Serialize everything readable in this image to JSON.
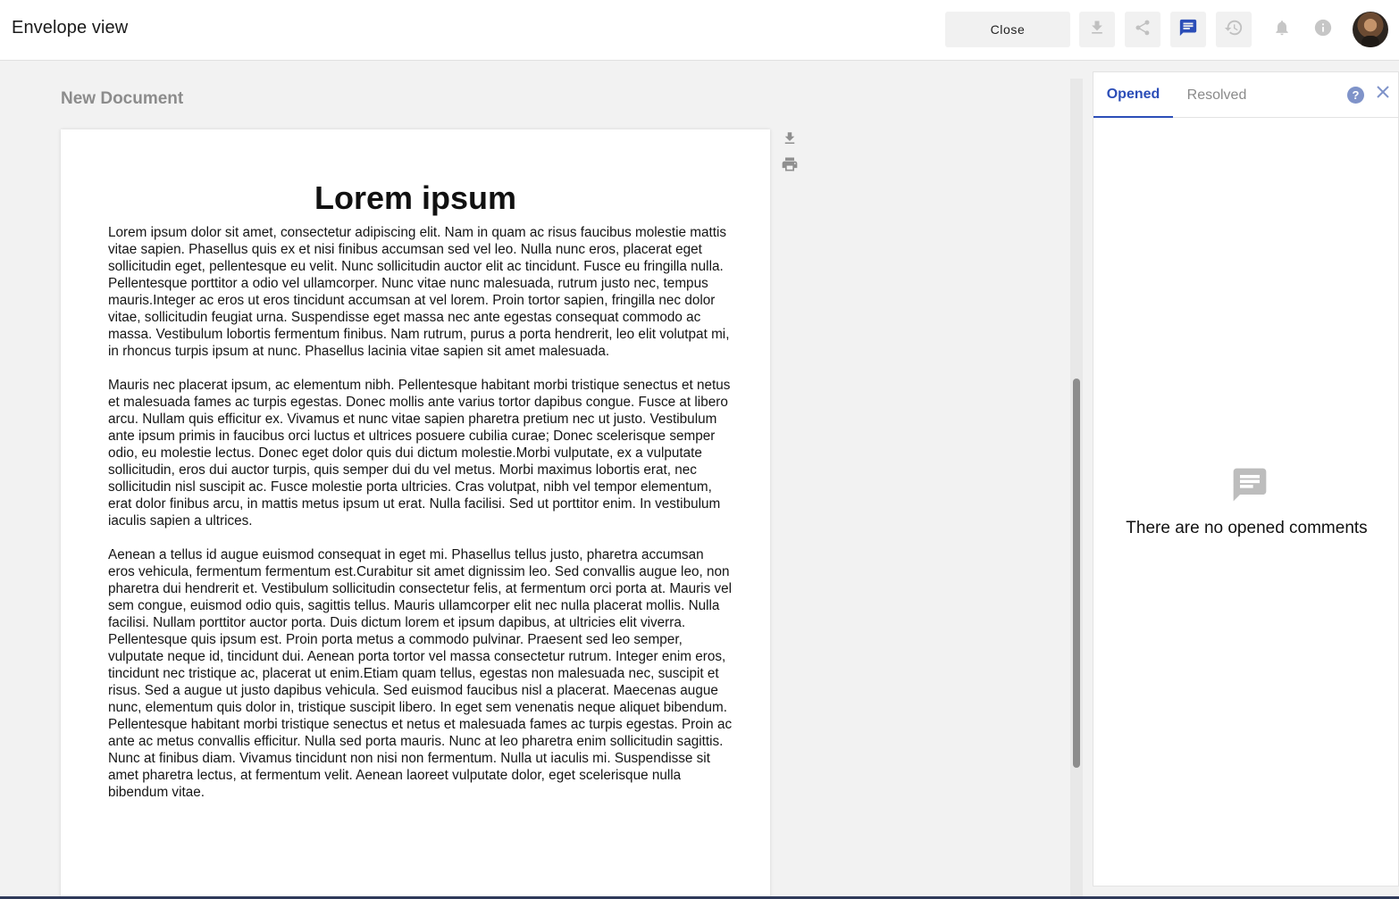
{
  "header": {
    "title": "Envelope view",
    "close_label": "Close"
  },
  "document": {
    "name": "New Document",
    "heading": "Lorem ipsum",
    "paragraphs": [
      "Lorem ipsum dolor sit amet, consectetur adipiscing elit. Nam in quam ac risus faucibus molestie mattis vitae sapien. Phasellus quis ex et nisi finibus accumsan sed vel leo. Nulla nunc eros, placerat eget sollicitudin eget, pellentesque eu velit. Nunc sollicitudin auctor elit ac tincidunt. Fusce eu fringilla nulla. Pellentesque porttitor a odio vel ullamcorper. Nunc vitae nunc malesuada, rutrum justo nec, tempus mauris.Integer ac eros ut eros tincidunt accumsan at vel lorem. Proin tortor sapien, fringilla nec dolor vitae, sollicitudin feugiat urna. Suspendisse eget massa nec ante egestas consequat commodo ac massa. Vestibulum lobortis fermentum finibus. Nam rutrum, purus a porta hendrerit, leo elit volutpat mi, in rhoncus turpis ipsum at nunc. Phasellus lacinia vitae sapien sit amet malesuada.",
      "Mauris nec placerat ipsum, ac elementum nibh. Pellentesque habitant morbi tristique senectus et netus et malesuada fames ac turpis egestas. Donec mollis ante varius tortor dapibus congue. Fusce at libero arcu. Nullam quis efficitur ex. Vivamus et nunc vitae sapien pharetra pretium nec ut justo. Vestibulum ante ipsum primis in faucibus orci luctus et ultrices posuere cubilia curae; Donec scelerisque semper odio, eu molestie lectus. Donec eget dolor quis dui dictum molestie.Morbi vulputate, ex a vulputate sollicitudin, eros dui auctor turpis, quis semper dui du vel metus. Morbi maximus lobortis erat, nec sollicitudin nisl suscipit ac. Fusce molestie porta ultricies. Cras volutpat, nibh vel tempor elementum, erat dolor finibus arcu, in mattis metus ipsum ut erat. Nulla facilisi. Sed ut porttitor enim. In vestibulum iaculis sapien a ultrices.",
      "Aenean a tellus id augue euismod consequat in eget mi. Phasellus tellus justo, pharetra accumsan eros vehicula, fermentum fermentum est.Curabitur sit amet dignissim leo. Sed convallis augue leo, non pharetra dui hendrerit et. Vestibulum sollicitudin consectetur felis, at fermentum orci porta at. Mauris vel sem congue, euismod odio quis, sagittis tellus. Mauris ullamcorper elit nec nulla placerat mollis. Nulla facilisi. Nullam porttitor auctor porta. Duis dictum lorem et ipsum dapibus, at ultricies elit viverra. Pellentesque quis ipsum est. Proin porta metus a commodo pulvinar. Praesent sed leo semper, vulputate neque id, tincidunt dui. Aenean porta tortor vel massa consectetur rutrum. Integer enim eros, tincidunt nec tristique ac, placerat ut enim.Etiam quam tellus, egestas non malesuada nec, suscipit et risus. Sed a augue ut justo dapibus vehicula. Sed euismod faucibus nisl a placerat. Maecenas augue nunc, elementum quis dolor in, tristique suscipit libero. In eget sem venenatis neque aliquet bibendum. Pellentesque habitant morbi tristique senectus et netus et malesuada fames ac turpis egestas. Proin ac ante ac metus convallis efficitur. Nulla sed porta mauris. Nunc at leo pharetra enim sollicitudin sagittis. Nunc at finibus diam. Vivamus tincidunt non nisi non fermentum. Nulla ut iaculis mi. Suspendisse sit amet pharetra lectus, at fermentum velit. Aenean laoreet vulputate dolor, eget scelerisque nulla bibendum vitae."
    ]
  },
  "comments_panel": {
    "tabs": [
      "Opened",
      "Resolved"
    ],
    "active_tab": "Opened",
    "empty_message": "There are no opened comments"
  },
  "icons": {
    "toolbar": [
      "download-icon",
      "share-icon",
      "comment-icon",
      "history-icon",
      "bell-icon",
      "info-icon"
    ],
    "document_tools": [
      "download-icon",
      "print-icon"
    ],
    "panel": [
      "help-icon",
      "close-icon",
      "comment-icon"
    ]
  },
  "colors": {
    "accent": "#2c4eb8",
    "icon_muted": "#bdbdbd",
    "toolbar_button_bg": "#f1f1f1"
  }
}
